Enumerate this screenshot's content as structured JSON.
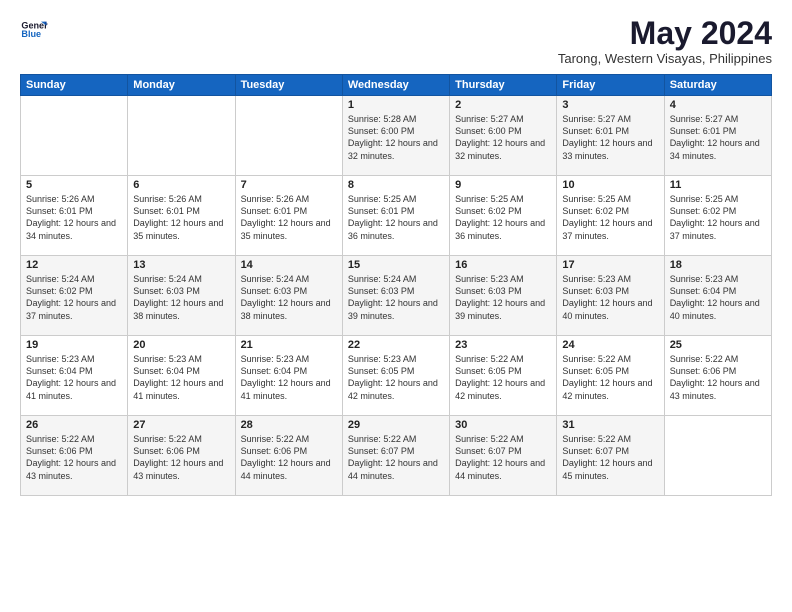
{
  "logo": {
    "line1": "General",
    "line2": "Blue"
  },
  "title": "May 2024",
  "location": "Tarong, Western Visayas, Philippines",
  "days_header": [
    "Sunday",
    "Monday",
    "Tuesday",
    "Wednesday",
    "Thursday",
    "Friday",
    "Saturday"
  ],
  "weeks": [
    [
      {
        "day": "",
        "sunrise": "",
        "sunset": "",
        "daylight": ""
      },
      {
        "day": "",
        "sunrise": "",
        "sunset": "",
        "daylight": ""
      },
      {
        "day": "",
        "sunrise": "",
        "sunset": "",
        "daylight": ""
      },
      {
        "day": "1",
        "sunrise": "Sunrise: 5:28 AM",
        "sunset": "Sunset: 6:00 PM",
        "daylight": "Daylight: 12 hours and 32 minutes."
      },
      {
        "day": "2",
        "sunrise": "Sunrise: 5:27 AM",
        "sunset": "Sunset: 6:00 PM",
        "daylight": "Daylight: 12 hours and 32 minutes."
      },
      {
        "day": "3",
        "sunrise": "Sunrise: 5:27 AM",
        "sunset": "Sunset: 6:01 PM",
        "daylight": "Daylight: 12 hours and 33 minutes."
      },
      {
        "day": "4",
        "sunrise": "Sunrise: 5:27 AM",
        "sunset": "Sunset: 6:01 PM",
        "daylight": "Daylight: 12 hours and 34 minutes."
      }
    ],
    [
      {
        "day": "5",
        "sunrise": "Sunrise: 5:26 AM",
        "sunset": "Sunset: 6:01 PM",
        "daylight": "Daylight: 12 hours and 34 minutes."
      },
      {
        "day": "6",
        "sunrise": "Sunrise: 5:26 AM",
        "sunset": "Sunset: 6:01 PM",
        "daylight": "Daylight: 12 hours and 35 minutes."
      },
      {
        "day": "7",
        "sunrise": "Sunrise: 5:26 AM",
        "sunset": "Sunset: 6:01 PM",
        "daylight": "Daylight: 12 hours and 35 minutes."
      },
      {
        "day": "8",
        "sunrise": "Sunrise: 5:25 AM",
        "sunset": "Sunset: 6:01 PM",
        "daylight": "Daylight: 12 hours and 36 minutes."
      },
      {
        "day": "9",
        "sunrise": "Sunrise: 5:25 AM",
        "sunset": "Sunset: 6:02 PM",
        "daylight": "Daylight: 12 hours and 36 minutes."
      },
      {
        "day": "10",
        "sunrise": "Sunrise: 5:25 AM",
        "sunset": "Sunset: 6:02 PM",
        "daylight": "Daylight: 12 hours and 37 minutes."
      },
      {
        "day": "11",
        "sunrise": "Sunrise: 5:25 AM",
        "sunset": "Sunset: 6:02 PM",
        "daylight": "Daylight: 12 hours and 37 minutes."
      }
    ],
    [
      {
        "day": "12",
        "sunrise": "Sunrise: 5:24 AM",
        "sunset": "Sunset: 6:02 PM",
        "daylight": "Daylight: 12 hours and 37 minutes."
      },
      {
        "day": "13",
        "sunrise": "Sunrise: 5:24 AM",
        "sunset": "Sunset: 6:03 PM",
        "daylight": "Daylight: 12 hours and 38 minutes."
      },
      {
        "day": "14",
        "sunrise": "Sunrise: 5:24 AM",
        "sunset": "Sunset: 6:03 PM",
        "daylight": "Daylight: 12 hours and 38 minutes."
      },
      {
        "day": "15",
        "sunrise": "Sunrise: 5:24 AM",
        "sunset": "Sunset: 6:03 PM",
        "daylight": "Daylight: 12 hours and 39 minutes."
      },
      {
        "day": "16",
        "sunrise": "Sunrise: 5:23 AM",
        "sunset": "Sunset: 6:03 PM",
        "daylight": "Daylight: 12 hours and 39 minutes."
      },
      {
        "day": "17",
        "sunrise": "Sunrise: 5:23 AM",
        "sunset": "Sunset: 6:03 PM",
        "daylight": "Daylight: 12 hours and 40 minutes."
      },
      {
        "day": "18",
        "sunrise": "Sunrise: 5:23 AM",
        "sunset": "Sunset: 6:04 PM",
        "daylight": "Daylight: 12 hours and 40 minutes."
      }
    ],
    [
      {
        "day": "19",
        "sunrise": "Sunrise: 5:23 AM",
        "sunset": "Sunset: 6:04 PM",
        "daylight": "Daylight: 12 hours and 41 minutes."
      },
      {
        "day": "20",
        "sunrise": "Sunrise: 5:23 AM",
        "sunset": "Sunset: 6:04 PM",
        "daylight": "Daylight: 12 hours and 41 minutes."
      },
      {
        "day": "21",
        "sunrise": "Sunrise: 5:23 AM",
        "sunset": "Sunset: 6:04 PM",
        "daylight": "Daylight: 12 hours and 41 minutes."
      },
      {
        "day": "22",
        "sunrise": "Sunrise: 5:23 AM",
        "sunset": "Sunset: 6:05 PM",
        "daylight": "Daylight: 12 hours and 42 minutes."
      },
      {
        "day": "23",
        "sunrise": "Sunrise: 5:22 AM",
        "sunset": "Sunset: 6:05 PM",
        "daylight": "Daylight: 12 hours and 42 minutes."
      },
      {
        "day": "24",
        "sunrise": "Sunrise: 5:22 AM",
        "sunset": "Sunset: 6:05 PM",
        "daylight": "Daylight: 12 hours and 42 minutes."
      },
      {
        "day": "25",
        "sunrise": "Sunrise: 5:22 AM",
        "sunset": "Sunset: 6:06 PM",
        "daylight": "Daylight: 12 hours and 43 minutes."
      }
    ],
    [
      {
        "day": "26",
        "sunrise": "Sunrise: 5:22 AM",
        "sunset": "Sunset: 6:06 PM",
        "daylight": "Daylight: 12 hours and 43 minutes."
      },
      {
        "day": "27",
        "sunrise": "Sunrise: 5:22 AM",
        "sunset": "Sunset: 6:06 PM",
        "daylight": "Daylight: 12 hours and 43 minutes."
      },
      {
        "day": "28",
        "sunrise": "Sunrise: 5:22 AM",
        "sunset": "Sunset: 6:06 PM",
        "daylight": "Daylight: 12 hours and 44 minutes."
      },
      {
        "day": "29",
        "sunrise": "Sunrise: 5:22 AM",
        "sunset": "Sunset: 6:07 PM",
        "daylight": "Daylight: 12 hours and 44 minutes."
      },
      {
        "day": "30",
        "sunrise": "Sunrise: 5:22 AM",
        "sunset": "Sunset: 6:07 PM",
        "daylight": "Daylight: 12 hours and 44 minutes."
      },
      {
        "day": "31",
        "sunrise": "Sunrise: 5:22 AM",
        "sunset": "Sunset: 6:07 PM",
        "daylight": "Daylight: 12 hours and 45 minutes."
      },
      {
        "day": "",
        "sunrise": "",
        "sunset": "",
        "daylight": ""
      }
    ]
  ]
}
